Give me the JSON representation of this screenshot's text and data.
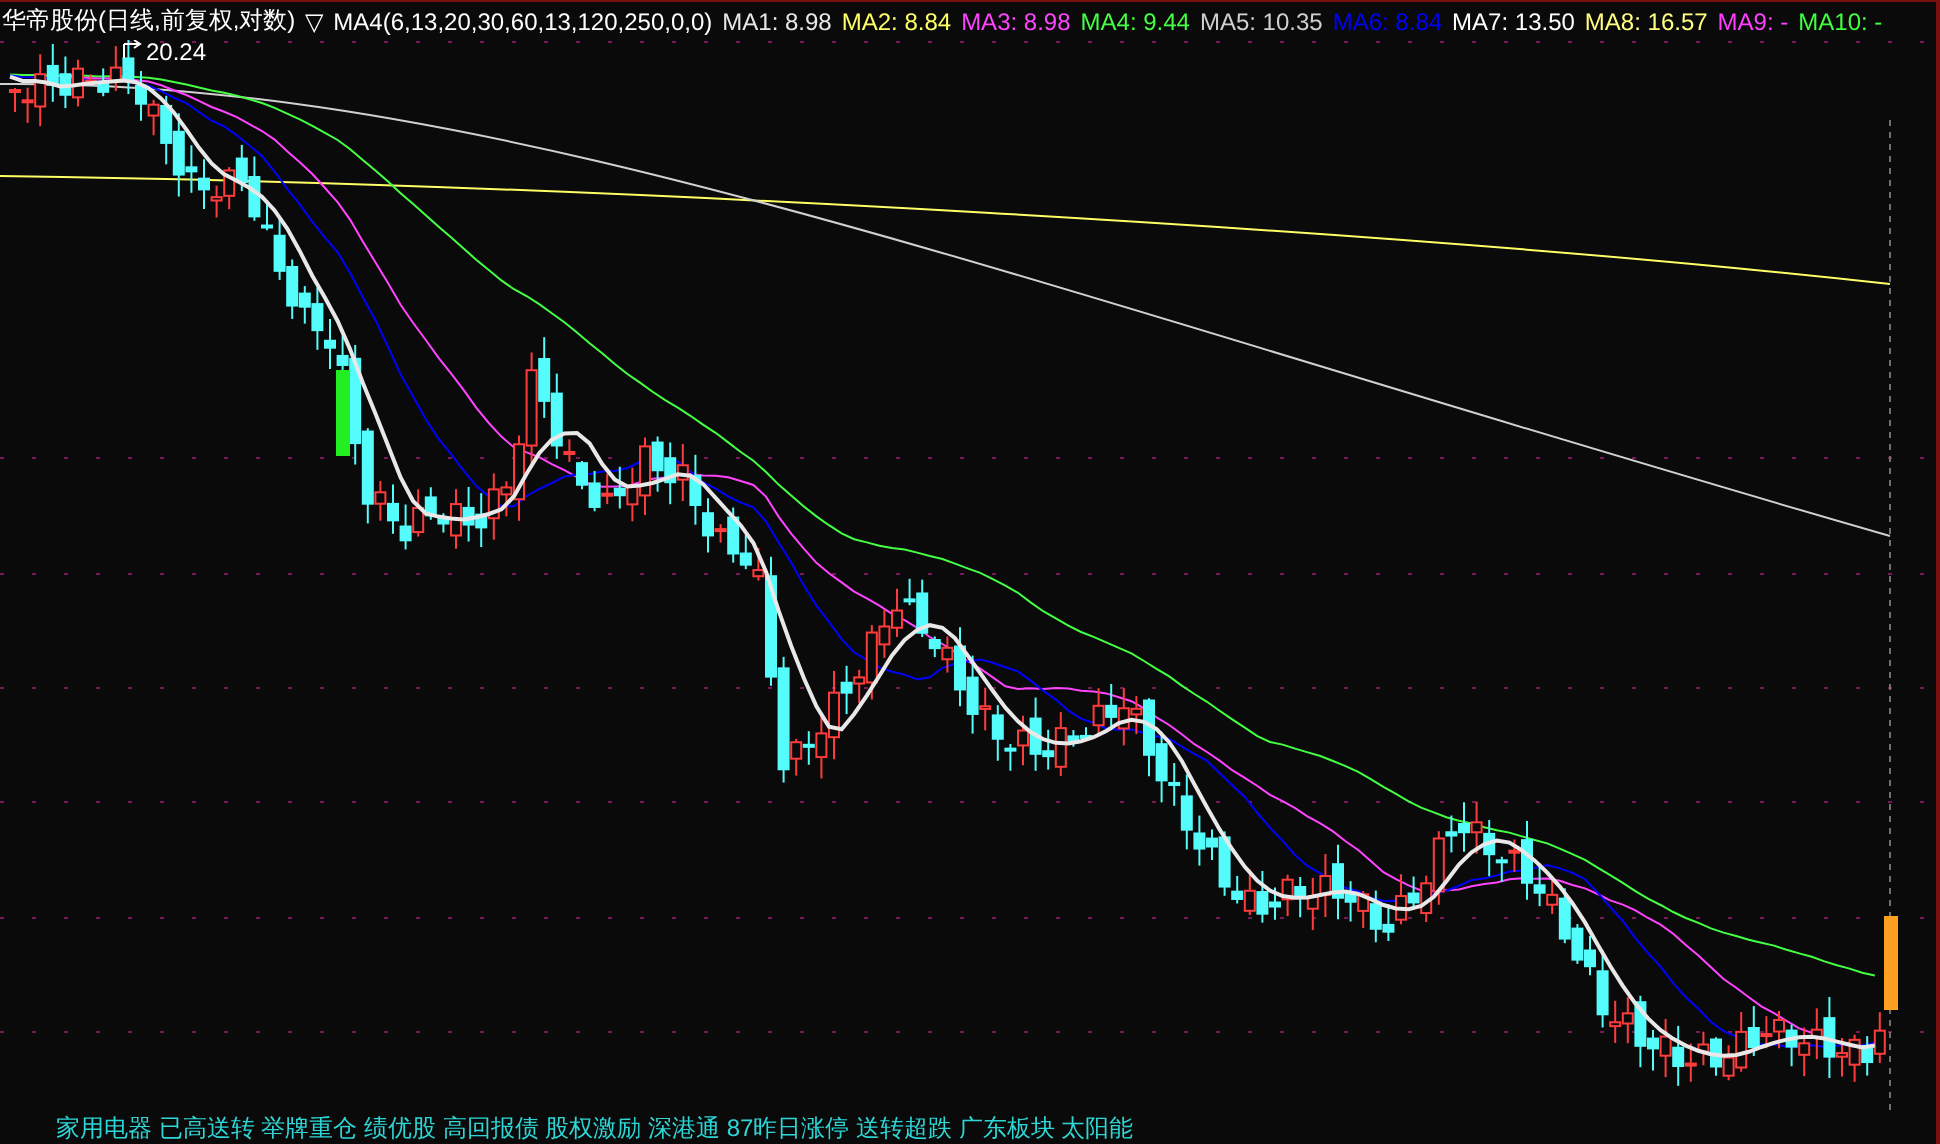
{
  "chart": {
    "title": "华帝股份(日线,前复权,对数)",
    "indicator_toggle": "▽",
    "indicator": "MA4(6,13,20,30,60,13,120,250,0,0)",
    "legend": [
      {
        "label": "MA1: 8.98",
        "color": "#e8e8e8"
      },
      {
        "label": "MA2: 8.84",
        "color": "#ffff66"
      },
      {
        "label": "MA3: 8.98",
        "color": "#ff44ff"
      },
      {
        "label": "MA4: 9.44",
        "color": "#44ff44"
      },
      {
        "label": "MA5: 10.35",
        "color": "#d0d0d0"
      },
      {
        "label": "MA6: 8.84",
        "color": "#0000ff"
      },
      {
        "label": "MA7: 13.50",
        "color": "#ffffff"
      },
      {
        "label": "MA8: 16.57",
        "color": "#ffff80"
      },
      {
        "label": "MA9: -",
        "color": "#ff40ff"
      },
      {
        "label": "MA10: -",
        "color": "#40ff40"
      }
    ],
    "high_marker": "20.24"
  },
  "status_text": "家用电器 已高送转 举牌重仓 绩优股 高回报债 股权激励 深港通 87昨日涨停 送转超跌 广东板块 太阳能"
}
